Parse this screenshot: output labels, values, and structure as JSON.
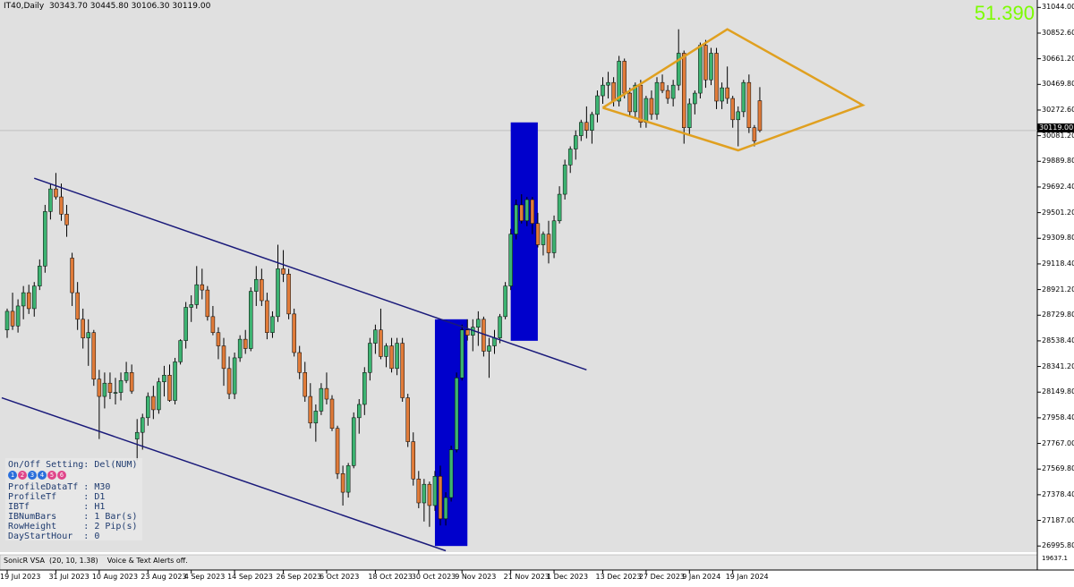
{
  "header": {
    "symbol_info": "IT40,Daily  30343.70 30445.80 30106.30 30119.00",
    "spread_value": "51.390"
  },
  "info_panel": {
    "title": "On/Off Setting: Del(NUM)",
    "buttons": [
      {
        "label": "1",
        "color": "#2a6fdb"
      },
      {
        "label": "2",
        "color": "#e0458a"
      },
      {
        "label": "3",
        "color": "#2a6fdb"
      },
      {
        "label": "4",
        "color": "#2a6fdb"
      },
      {
        "label": "5",
        "color": "#e0458a"
      },
      {
        "label": "6",
        "color": "#e0458a"
      }
    ],
    "rows": [
      "ProfileDataTf : M30",
      "ProfileTf     : D1",
      "IBTf          : H1",
      "IBNumBars     : 1 Bar(s)",
      "RowHeight     : 2 Pip(s)",
      "DayStartHour  : 0"
    ]
  },
  "indicator": {
    "label": "SonicR VSA  (20, 10, 1.38)    Voice & Text Alerts off.",
    "right_value": "19637.1"
  },
  "current_price": "30119.00",
  "colors": {
    "bull": "#3cb371",
    "bear": "#e07b39",
    "channel": "#1a1a7a",
    "diamond": "#e0a020",
    "volume_box": "#0000cc",
    "price_line": "#bfbfbf"
  },
  "chart_data": {
    "type": "candlestick",
    "ylim": [
      26950,
      31100
    ],
    "y_ticks": [
      "31044.00",
      "30852.60",
      "30661.20",
      "30469.80",
      "30272.60",
      "30081.20",
      "29889.80",
      "29692.40",
      "29501.20",
      "29309.80",
      "29118.40",
      "28921.20",
      "28729.80",
      "28538.40",
      "28341.20",
      "28149.80",
      "27958.40",
      "27767.00",
      "27569.80",
      "27378.40",
      "27187.00",
      "26995.80"
    ],
    "x_ticks": [
      {
        "label": "19 Jul 2023",
        "index": 0
      },
      {
        "label": "31 Jul 2023",
        "index": 9
      },
      {
        "label": "10 Aug 2023",
        "index": 17
      },
      {
        "label": "23 Aug 2023",
        "index": 26
      },
      {
        "label": "4 Sep 2023",
        "index": 34
      },
      {
        "label": "14 Sep 2023",
        "index": 42
      },
      {
        "label": "26 Sep 2023",
        "index": 51
      },
      {
        "label": "6 Oct 2023",
        "index": 59
      },
      {
        "label": "18 Oct 2023",
        "index": 68
      },
      {
        "label": "30 Oct 2023",
        "index": 76
      },
      {
        "label": "9 Nov 2023",
        "index": 84
      },
      {
        "label": "21 Nov 2023",
        "index": 93
      },
      {
        "label": "1 Dec 2023",
        "index": 101
      },
      {
        "label": "13 Dec 2023",
        "index": 110
      },
      {
        "label": "27 Dec 2023",
        "index": 118
      },
      {
        "label": "9 Jan 2024",
        "index": 126
      },
      {
        "label": "19 Jan 2024",
        "index": 134
      }
    ],
    "candles": [
      [
        28620,
        28780,
        28560,
        28760
      ],
      [
        28760,
        28900,
        28620,
        28650
      ],
      [
        28650,
        28850,
        28600,
        28800
      ],
      [
        28800,
        28950,
        28700,
        28900
      ],
      [
        28900,
        28960,
        28740,
        28780
      ],
      [
        28780,
        28980,
        28720,
        28950
      ],
      [
        28950,
        29150,
        28920,
        29100
      ],
      [
        29100,
        29560,
        29050,
        29510
      ],
      [
        29510,
        29720,
        29450,
        29680
      ],
      [
        29680,
        29800,
        29600,
        29620
      ],
      [
        29620,
        29720,
        29440,
        29490
      ],
      [
        29490,
        29560,
        29320,
        29410
      ],
      [
        29160,
        29200,
        28800,
        28900
      ],
      [
        28900,
        28980,
        28620,
        28700
      ],
      [
        28700,
        28780,
        28480,
        28560
      ],
      [
        28560,
        28700,
        28350,
        28600
      ],
      [
        28600,
        28620,
        28200,
        28250
      ],
      [
        28250,
        28320,
        27800,
        28120
      ],
      [
        28120,
        28300,
        28030,
        28220
      ],
      [
        28220,
        28300,
        28100,
        28150
      ],
      [
        28150,
        28260,
        28060,
        28150
      ],
      [
        28150,
        28300,
        28090,
        28240
      ],
      [
        28240,
        28380,
        28220,
        28300
      ],
      [
        28300,
        28360,
        28140,
        28160
      ],
      [
        27800,
        27950,
        27640,
        27850
      ],
      [
        27850,
        27990,
        27720,
        27960
      ],
      [
        27960,
        28150,
        27900,
        28120
      ],
      [
        28120,
        28200,
        27950,
        28020
      ],
      [
        28020,
        28260,
        27990,
        28230
      ],
      [
        28230,
        28350,
        28120,
        28280
      ],
      [
        28280,
        28360,
        28080,
        28090
      ],
      [
        28090,
        28410,
        28060,
        28380
      ],
      [
        28380,
        28550,
        28360,
        28540
      ],
      [
        28540,
        28830,
        28480,
        28790
      ],
      [
        28790,
        28880,
        28680,
        28810
      ],
      [
        28810,
        29100,
        28780,
        28960
      ],
      [
        28960,
        29080,
        28850,
        28920
      ],
      [
        28920,
        28950,
        28690,
        28720
      ],
      [
        28720,
        28800,
        28580,
        28600
      ],
      [
        28600,
        28640,
        28400,
        28500
      ],
      [
        28500,
        28560,
        28200,
        28330
      ],
      [
        28330,
        28420,
        28100,
        28140
      ],
      [
        28140,
        28450,
        28100,
        28410
      ],
      [
        28410,
        28580,
        28380,
        28550
      ],
      [
        28550,
        28620,
        28440,
        28480
      ],
      [
        28480,
        28940,
        28460,
        28910
      ],
      [
        28910,
        29100,
        28800,
        29000
      ],
      [
        29000,
        29080,
        28800,
        28840
      ],
      [
        28840,
        28900,
        28550,
        28600
      ],
      [
        28600,
        28760,
        28560,
        28720
      ],
      [
        28720,
        29260,
        28680,
        29080
      ],
      [
        29080,
        29220,
        28980,
        29040
      ],
      [
        29040,
        29080,
        28700,
        28740
      ],
      [
        28740,
        28780,
        28420,
        28450
      ],
      [
        28450,
        28500,
        28250,
        28300
      ],
      [
        28300,
        28380,
        28080,
        28120
      ],
      [
        28120,
        28220,
        27880,
        27920
      ],
      [
        27920,
        28060,
        27780,
        28010
      ],
      [
        28010,
        28220,
        27980,
        28180
      ],
      [
        28180,
        28300,
        28060,
        28100
      ],
      [
        28100,
        28130,
        27860,
        27880
      ],
      [
        27880,
        27900,
        27500,
        27540
      ],
      [
        27540,
        27600,
        27300,
        27400
      ],
      [
        27400,
        27620,
        27360,
        27600
      ],
      [
        27600,
        28000,
        27580,
        27960
      ],
      [
        27960,
        28100,
        27840,
        28060
      ],
      [
        28060,
        28340,
        27980,
        28300
      ],
      [
        28300,
        28560,
        28240,
        28520
      ],
      [
        28520,
        28660,
        28440,
        28620
      ],
      [
        28620,
        28780,
        28400,
        28420
      ],
      [
        28420,
        28520,
        28340,
        28500
      ],
      [
        28500,
        28560,
        28300,
        28330
      ],
      [
        28330,
        28560,
        28280,
        28520
      ],
      [
        28520,
        28560,
        28080,
        28110
      ],
      [
        28110,
        28140,
        27740,
        27780
      ],
      [
        27780,
        27850,
        27450,
        27500
      ],
      [
        27500,
        27560,
        27280,
        27320
      ],
      [
        27320,
        27500,
        27180,
        27460
      ],
      [
        27460,
        27480,
        27140,
        27300
      ],
      [
        27300,
        27560,
        27260,
        27520
      ],
      [
        27520,
        27600,
        27150,
        27200
      ],
      [
        27200,
        27400,
        27150,
        27360
      ],
      [
        27360,
        27750,
        27330,
        27720
      ],
      [
        27720,
        28300,
        27700,
        28260
      ],
      [
        28260,
        28660,
        28240,
        28620
      ],
      [
        28620,
        28700,
        28540,
        28580
      ],
      [
        28580,
        28700,
        28460,
        28640
      ],
      [
        28640,
        28760,
        28500,
        28700
      ],
      [
        28700,
        28720,
        28420,
        28460
      ],
      [
        28460,
        28560,
        28260,
        28500
      ],
      [
        28500,
        28620,
        28440,
        28560
      ],
      [
        28560,
        28740,
        28520,
        28720
      ],
      [
        28720,
        28980,
        28700,
        28950
      ],
      [
        28950,
        29380,
        28920,
        29340
      ],
      [
        29340,
        29600,
        29300,
        29560
      ],
      [
        29560,
        29640,
        29420,
        29440
      ],
      [
        29440,
        29620,
        29400,
        29600
      ],
      [
        29600,
        29620,
        29340,
        29420
      ],
      [
        29420,
        29500,
        29240,
        29260
      ],
      [
        29260,
        29360,
        29180,
        29340
      ],
      [
        29340,
        29440,
        29120,
        29200
      ],
      [
        29200,
        29480,
        29160,
        29440
      ],
      [
        29440,
        29700,
        29420,
        29640
      ],
      [
        29640,
        29900,
        29600,
        29860
      ],
      [
        29860,
        30000,
        29800,
        29980
      ],
      [
        29980,
        30120,
        29900,
        30080
      ],
      [
        30080,
        30200,
        30040,
        30180
      ],
      [
        30180,
        30300,
        30060,
        30120
      ],
      [
        30120,
        30260,
        30020,
        30240
      ],
      [
        30240,
        30420,
        30180,
        30380
      ],
      [
        30380,
        30520,
        30320,
        30460
      ],
      [
        30460,
        30560,
        30360,
        30480
      ],
      [
        30480,
        30520,
        30300,
        30340
      ],
      [
        30340,
        30680,
        30300,
        30640
      ],
      [
        30640,
        30660,
        30360,
        30400
      ],
      [
        30400,
        30440,
        30220,
        30260
      ],
      [
        30260,
        30480,
        30220,
        30460
      ],
      [
        30460,
        30500,
        30140,
        30180
      ],
      [
        30180,
        30380,
        30140,
        30360
      ],
      [
        30360,
        30420,
        30200,
        30240
      ],
      [
        30240,
        30520,
        30200,
        30480
      ],
      [
        30480,
        30540,
        30400,
        30420
      ],
      [
        30420,
        30460,
        30320,
        30360
      ],
      [
        30360,
        30500,
        30300,
        30460
      ],
      [
        30460,
        30880,
        30420,
        30700
      ],
      [
        30700,
        30720,
        30020,
        30140
      ],
      [
        30140,
        30360,
        30080,
        30320
      ],
      [
        30320,
        30420,
        30240,
        30400
      ],
      [
        30400,
        30780,
        30360,
        30760
      ],
      [
        30760,
        30800,
        30440,
        30500
      ],
      [
        30500,
        30740,
        30460,
        30700
      ],
      [
        30700,
        30740,
        30280,
        30340
      ],
      [
        30340,
        30480,
        30280,
        30440
      ],
      [
        30440,
        30600,
        30320,
        30360
      ],
      [
        30360,
        30380,
        30140,
        30200
      ],
      [
        30200,
        30300,
        30000,
        30260
      ],
      [
        30260,
        30500,
        30220,
        30480
      ],
      [
        30480,
        30540,
        30100,
        30140
      ],
      [
        30140,
        30160,
        30000,
        30040
      ],
      [
        30343,
        30445,
        30106,
        30119
      ]
    ]
  }
}
